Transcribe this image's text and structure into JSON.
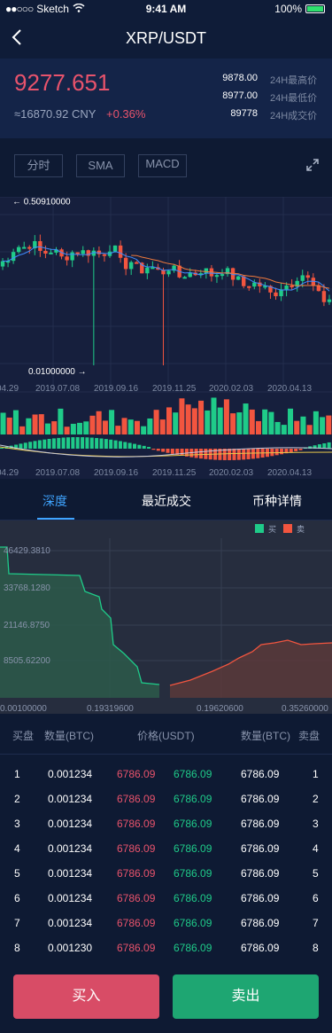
{
  "status_bar": {
    "carrier": "Sketch",
    "time": "9:41 AM",
    "battery": "100%"
  },
  "header": {
    "title": "XRP/USDT"
  },
  "ticker": {
    "price": "9277.651",
    "cny": "≈16870.92 CNY",
    "change": "+0.36%",
    "stats": [
      {
        "value": "9878.00",
        "label": "24H最高价"
      },
      {
        "value": "8977.00",
        "label": "24H最低价"
      },
      {
        "value": "89778",
        "label": "24H成交价"
      }
    ]
  },
  "toolbar": {
    "buttons": [
      "分时",
      "SMA",
      "MACD"
    ]
  },
  "kline": {
    "high_label": "← 0.50910000",
    "low_label": "0.01000000 →",
    "dates": [
      "04.29",
      "2019.07.08",
      "2019.09.16",
      "2019.11.25",
      "2020.02.03",
      "2020.04.13"
    ],
    "colors": {
      "up": "#1fcb89",
      "down": "#f2553f",
      "ma1": "#3f8cff",
      "ma2": "#f07a3c"
    }
  },
  "tabs": [
    "深度",
    "最近成交",
    "币种详情"
  ],
  "depth": {
    "legend": {
      "buy": "买",
      "sell": "卖"
    },
    "y_labels": [
      "46429.3810",
      "33768.1280",
      "21146.8750",
      "8505.62200"
    ],
    "x_labels": [
      "0.00100000",
      "0.19319600",
      "0.19620600",
      "0.35260000"
    ]
  },
  "book": {
    "headers": {
      "buy": "买盘",
      "qty_left": "数量(BTC)",
      "price": "价格(USDT)",
      "qty_right": "数量(BTC)",
      "sell": "卖盘"
    },
    "rows": [
      {
        "idx": "1",
        "qty_buy": "0.001234",
        "price_buy": "6786.09",
        "price_sell": "6786.09",
        "qty_sell": "6786.09",
        "sell_idx": "1"
      },
      {
        "idx": "2",
        "qty_buy": "0.001234",
        "price_buy": "6786.09",
        "price_sell": "6786.09",
        "qty_sell": "6786.09",
        "sell_idx": "2"
      },
      {
        "idx": "3",
        "qty_buy": "0.001234",
        "price_buy": "6786.09",
        "price_sell": "6786.09",
        "qty_sell": "6786.09",
        "sell_idx": "3"
      },
      {
        "idx": "4",
        "qty_buy": "0.001234",
        "price_buy": "6786.09",
        "price_sell": "6786.09",
        "qty_sell": "6786.09",
        "sell_idx": "4"
      },
      {
        "idx": "5",
        "qty_buy": "0.001234",
        "price_buy": "6786.09",
        "price_sell": "6786.09",
        "qty_sell": "6786.09",
        "sell_idx": "5"
      },
      {
        "idx": "6",
        "qty_buy": "0.001234",
        "price_buy": "6786.09",
        "price_sell": "6786.09",
        "qty_sell": "6786.09",
        "sell_idx": "6"
      },
      {
        "idx": "7",
        "qty_buy": "0.001234",
        "price_buy": "6786.09",
        "price_sell": "6786.09",
        "qty_sell": "6786.09",
        "sell_idx": "7"
      },
      {
        "idx": "8",
        "qty_buy": "0.001230",
        "price_buy": "6786.09",
        "price_sell": "6786.09",
        "qty_sell": "6786.09",
        "sell_idx": "8"
      }
    ]
  },
  "actions": {
    "buy": "买入",
    "sell": "卖出"
  }
}
